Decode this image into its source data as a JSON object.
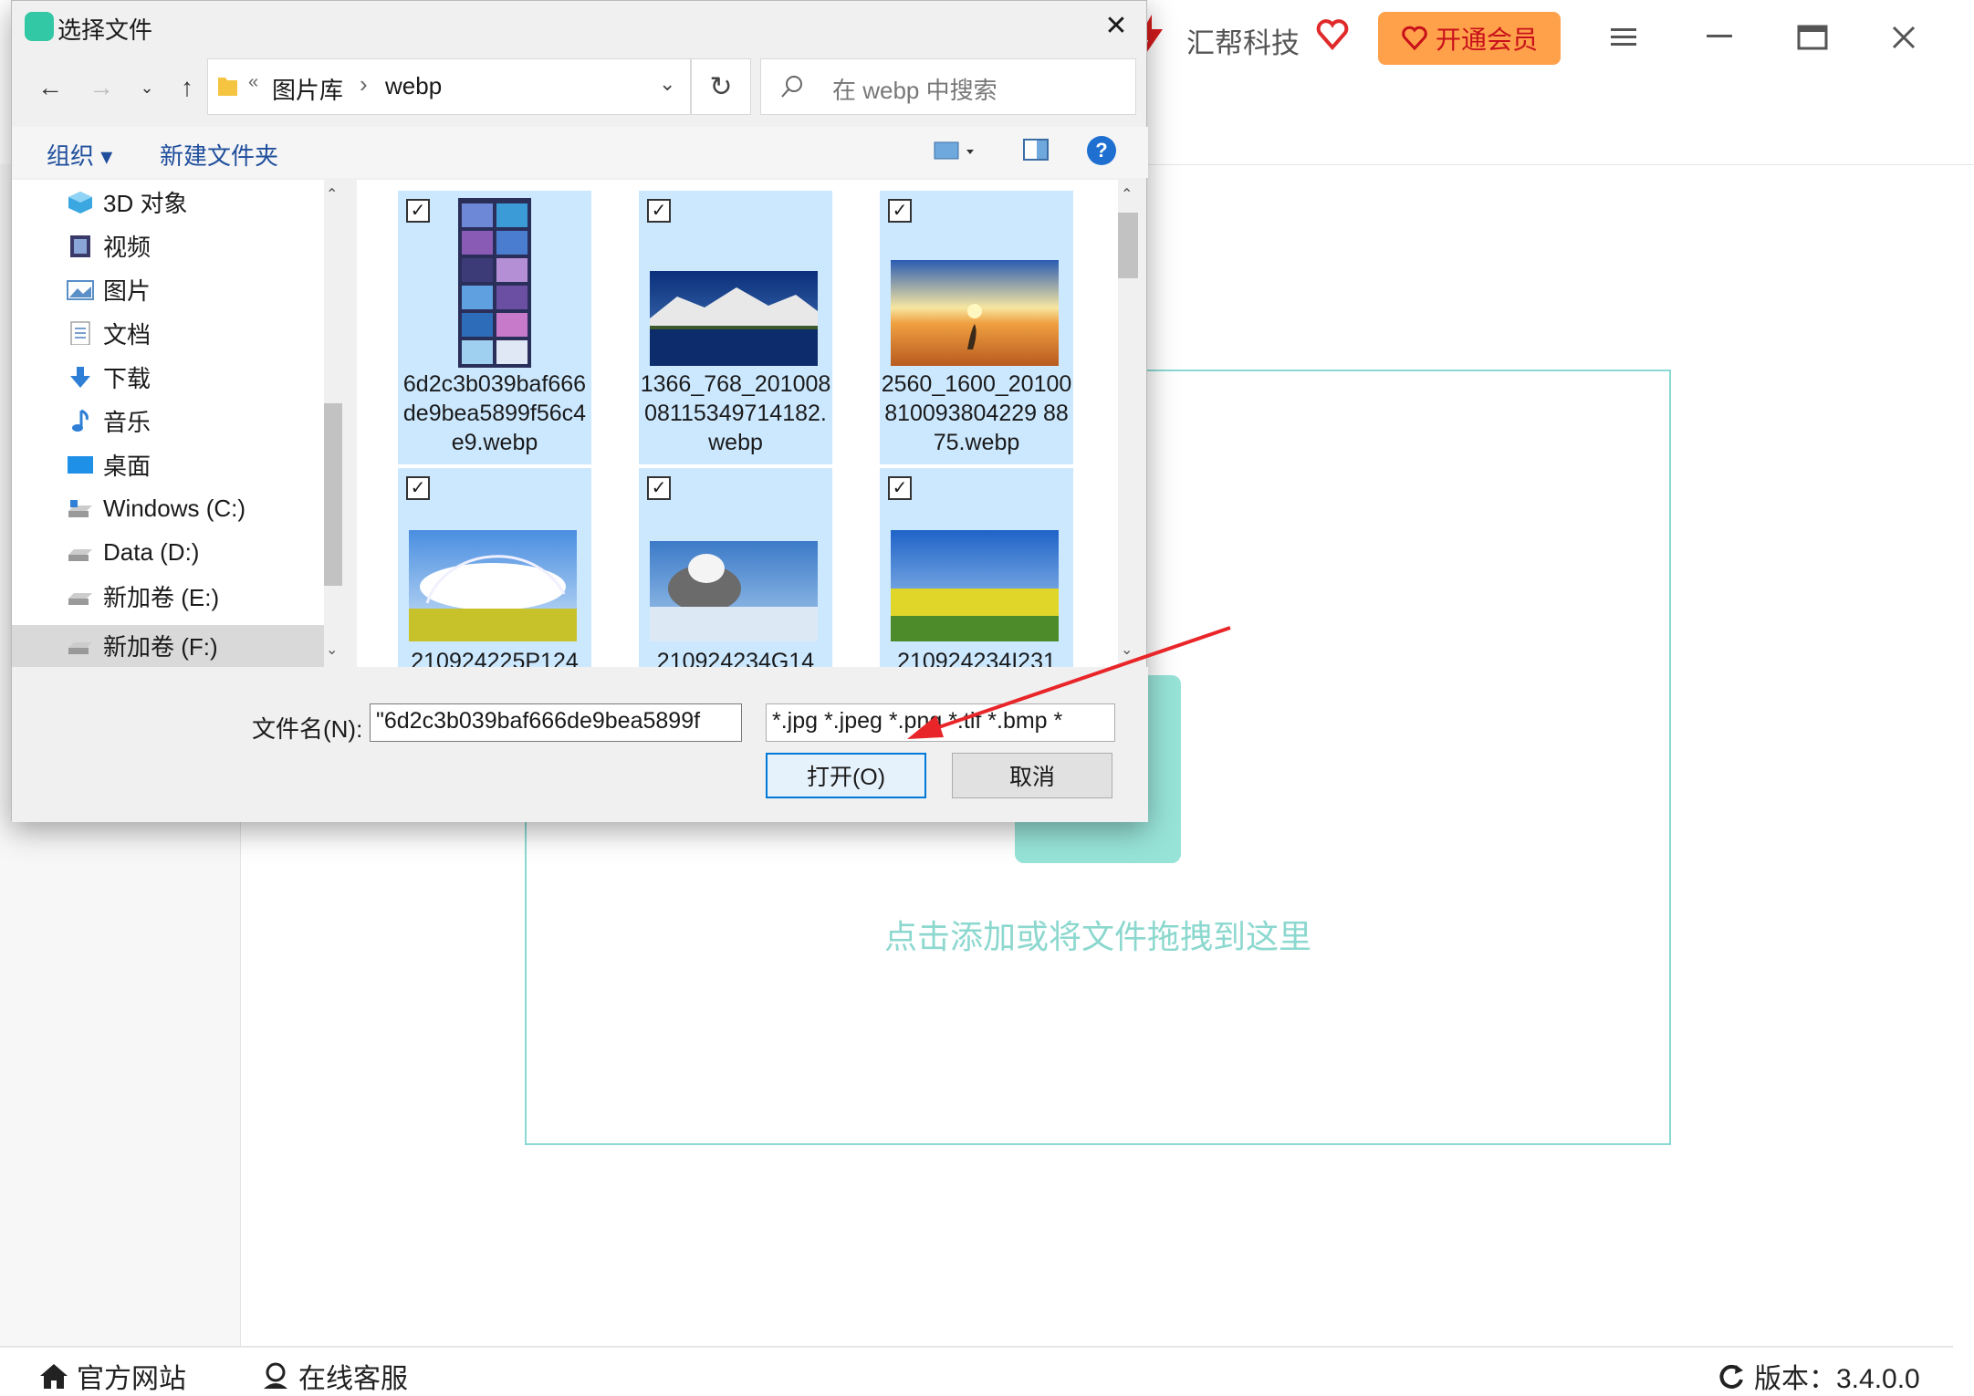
{
  "app": {
    "brand": "汇帮科技",
    "vip_label": "开通会员",
    "drop_hint": "点击添加或将文件拖拽到这里",
    "footer": {
      "website_label": "官方网站",
      "service_label": "在线客服",
      "version_label": "版本：3.4.0.0"
    }
  },
  "dialog": {
    "title": "选择文件",
    "breadcrumb": [
      "图片库",
      "webp"
    ],
    "breadcrumb_sep": "›",
    "breadcrumb_overflow": "«",
    "search_placeholder": "在 webp 中搜索",
    "toolbar": {
      "organize": "组织 ▾",
      "new_folder": "新建文件夹",
      "help": "?"
    },
    "nav_items": [
      {
        "label": "3D 对象",
        "icon": "3d-objects-icon"
      },
      {
        "label": "视频",
        "icon": "video-icon"
      },
      {
        "label": "图片",
        "icon": "pictures-icon"
      },
      {
        "label": "文档",
        "icon": "documents-icon"
      },
      {
        "label": "下载",
        "icon": "download-icon"
      },
      {
        "label": "音乐",
        "icon": "music-icon"
      },
      {
        "label": "桌面",
        "icon": "desktop-icon"
      },
      {
        "label": "Windows (C:)",
        "icon": "drive-icon"
      },
      {
        "label": "Data (D:)",
        "icon": "drive-icon"
      },
      {
        "label": "新加卷 (E:)",
        "icon": "drive-icon"
      },
      {
        "label": "新加卷 (F:)",
        "icon": "drive-icon"
      }
    ],
    "files": [
      {
        "name": "6d2c3b039baf666de9bea5899f56c4e9.webp",
        "checked": true
      },
      {
        "name": "1366_768_20100808115349714182.webp",
        "checked": true
      },
      {
        "name": "2560_1600_20100810093804229 8875.webp",
        "checked": true
      },
      {
        "name": "210924225P124",
        "checked": true
      },
      {
        "name": "210924234G14",
        "checked": true
      },
      {
        "name": "210924234I231",
        "checked": true
      }
    ],
    "filename_label": "文件名(N):",
    "filename_value": "\"6d2c3b039baf666de9bea5899f",
    "filter_value": "*.jpg *.jpeg *.png *.tif *.bmp *",
    "open_label": "打开(O)",
    "cancel_label": "取消"
  },
  "colors": {
    "accent": "#0078d7",
    "selection": "#cce8ff",
    "brand_teal": "#8ad9d2",
    "vip": "#ffa04a",
    "arrow": "#e8262a"
  }
}
